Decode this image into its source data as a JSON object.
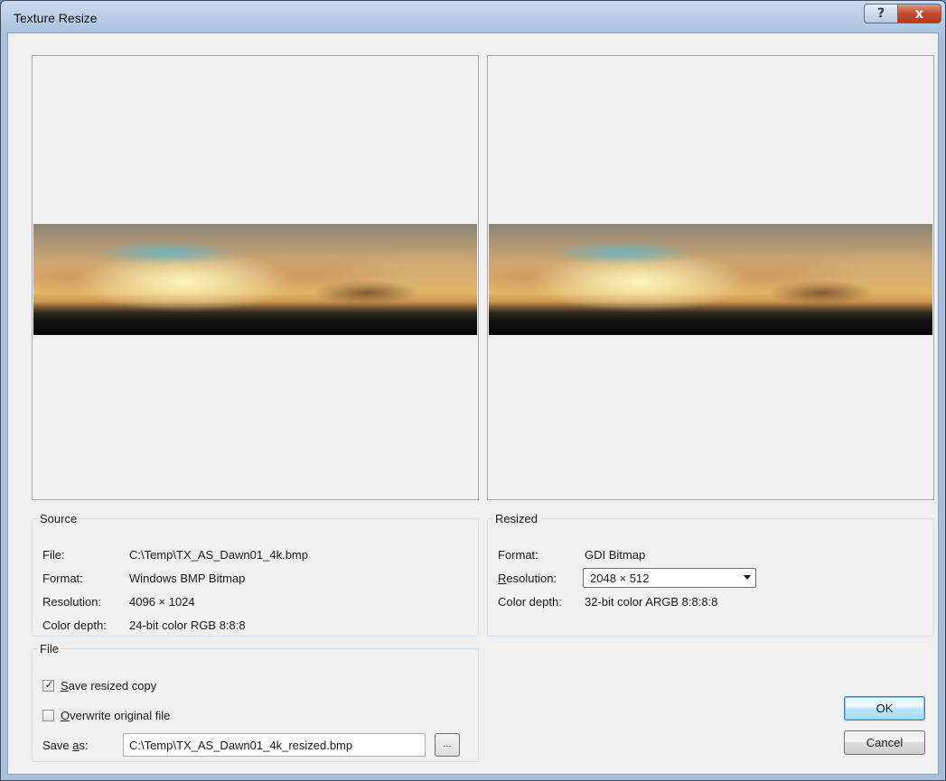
{
  "window": {
    "title": "Texture Resize",
    "help_label": "?",
    "close_label": "x"
  },
  "source": {
    "legend": "Source",
    "file_label": "File:",
    "file_value": "C:\\Temp\\TX_AS_Dawn01_4k.bmp",
    "format_label": "Format:",
    "format_value": "Windows BMP Bitmap",
    "resolution_label": "Resolution:",
    "resolution_value": "4096 × 1024",
    "color_depth_label": "Color depth:",
    "color_depth_value": "24-bit color RGB 8:8:8"
  },
  "resized": {
    "legend": "Resized",
    "format_label": "Format:",
    "format_value": "GDI Bitmap",
    "resolution_label_prefix": "R",
    "resolution_label_rest": "esolution:",
    "resolution_selected": "2048 × 512",
    "color_depth_label": "Color depth:",
    "color_depth_value": "32-bit color ARGB 8:8:8:8"
  },
  "file": {
    "legend": "File",
    "save_copy_checked": true,
    "save_copy_label_prefix": "S",
    "save_copy_label_rest": "ave resized copy",
    "overwrite_checked": false,
    "overwrite_label_prefix": "O",
    "overwrite_label_rest": "verwrite original file",
    "save_as_label_start": "Save ",
    "save_as_label_accel": "a",
    "save_as_label_end": "s:",
    "save_as_value": "C:\\Temp\\TX_AS_Dawn01_4k_resized.bmp",
    "browse_label": "..."
  },
  "buttons": {
    "ok": "OK",
    "cancel": "Cancel"
  },
  "icons": {
    "checkmark": "✓"
  }
}
